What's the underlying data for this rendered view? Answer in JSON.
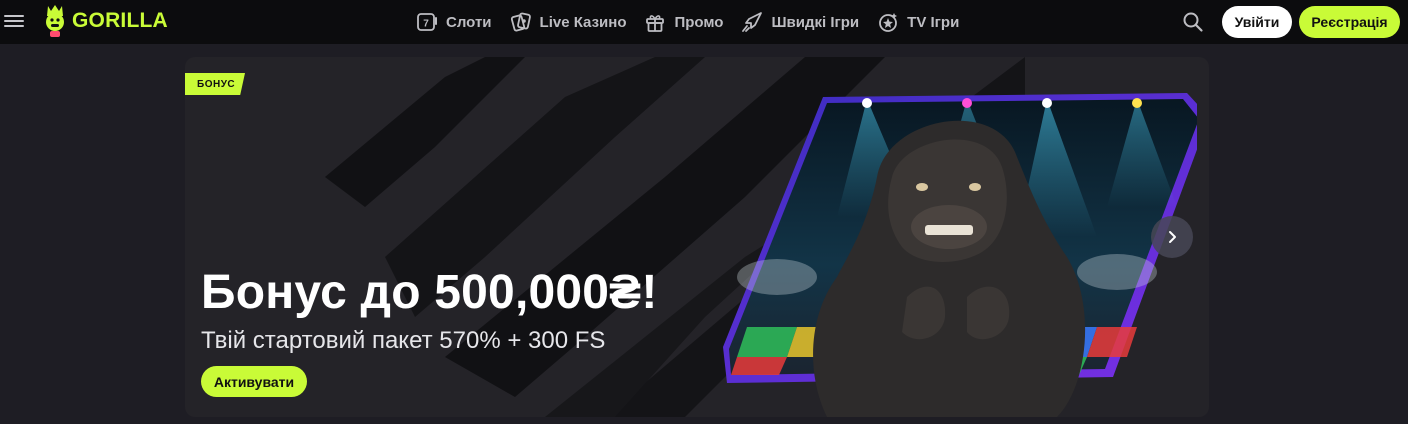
{
  "header": {
    "brand": "GORILLA",
    "nav": [
      {
        "label": "Слоти",
        "icon": "slots-icon"
      },
      {
        "label": "Live Казино",
        "icon": "live-cards-icon"
      },
      {
        "label": "Промо",
        "icon": "gift-icon"
      },
      {
        "label": "Швидкі Ігри",
        "icon": "rocket-icon"
      },
      {
        "label": "TV Ігри",
        "icon": "tv-games-icon"
      }
    ],
    "login_label": "Увійти",
    "register_label": "Реєстрація"
  },
  "banner": {
    "badge": "БОНУС",
    "title": "Бонус до 500,000₴!",
    "subtitle": "Твій стартовий пакет 570% + 300 FS",
    "cta_label": "Активувати"
  },
  "colors": {
    "accent": "#c9fb37",
    "header_bg": "#0c0c0e",
    "page_bg": "#1e1d24",
    "banner_bg": "#242328",
    "frame_purple": "#5b2bd9"
  }
}
